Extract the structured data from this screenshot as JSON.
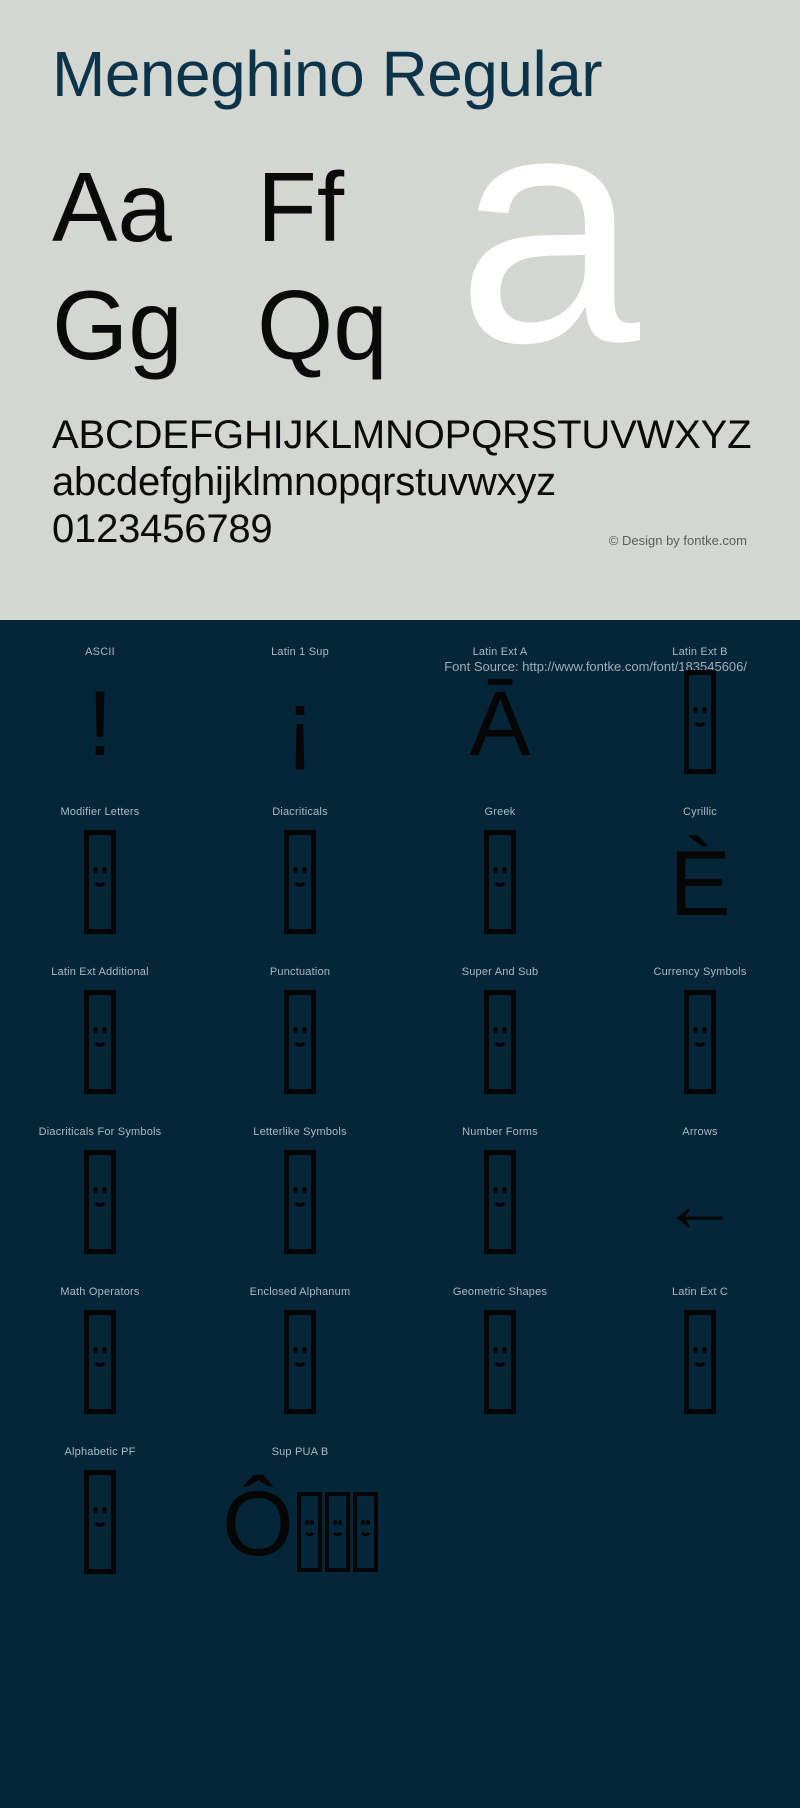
{
  "specimen": {
    "title": "Meneghino Regular",
    "watermark_letter": "a",
    "letter_pairs": [
      {
        "col1": "Aa",
        "col2": "Ff"
      },
      {
        "col1": "Gg",
        "col2": "Qq"
      }
    ],
    "alphabet_lines": [
      "ABCDEFGHIJKLMNOPQRSTUVWXYZ",
      "abcdefghijklmnopqrstuvwxyz",
      "0123456789"
    ],
    "design_credit": "© Design by fontke.com",
    "background_color": "#D4D7D1",
    "title_color": "#0B3349",
    "glyph_color": "#0A0A0A"
  },
  "blocks_section": {
    "font_source": "Font Source: http://www.fontke.com/font/183545606/",
    "background_color": "#052639",
    "label_color": "#A9BAC3",
    "blocks": [
      {
        "label": "ASCII",
        "glyph": "!",
        "kind": "char"
      },
      {
        "label": "Latin 1 Sup",
        "glyph": "¡",
        "kind": "char"
      },
      {
        "label": "Latin Ext A",
        "glyph": "Ā",
        "kind": "char"
      },
      {
        "label": "Latin Ext B",
        "glyph": "",
        "kind": "tofu"
      },
      {
        "label": "Modifier Letters",
        "glyph": "",
        "kind": "tofu"
      },
      {
        "label": "Diacriticals",
        "glyph": "",
        "kind": "tofu"
      },
      {
        "label": "Greek",
        "glyph": "",
        "kind": "tofu"
      },
      {
        "label": "Cyrillic",
        "glyph": "È",
        "kind": "char"
      },
      {
        "label": "Latin Ext Additional",
        "glyph": "",
        "kind": "tofu"
      },
      {
        "label": "Punctuation",
        "glyph": "",
        "kind": "tofu"
      },
      {
        "label": "Super And Sub",
        "glyph": "",
        "kind": "tofu"
      },
      {
        "label": "Currency Symbols",
        "glyph": "",
        "kind": "tofu"
      },
      {
        "label": "Diacriticals For Symbols",
        "glyph": "",
        "kind": "tofu"
      },
      {
        "label": "Letterlike Symbols",
        "glyph": "",
        "kind": "tofu"
      },
      {
        "label": "Number Forms",
        "glyph": "",
        "kind": "tofu"
      },
      {
        "label": "Arrows",
        "glyph": "←",
        "kind": "arrow"
      },
      {
        "label": "Math Operators",
        "glyph": "",
        "kind": "tofu"
      },
      {
        "label": "Enclosed Alphanum",
        "glyph": "",
        "kind": "tofu"
      },
      {
        "label": "Geometric Shapes",
        "glyph": "",
        "kind": "tofu"
      },
      {
        "label": "Latin Ext C",
        "glyph": "",
        "kind": "tofu"
      },
      {
        "label": "Alphabetic PF",
        "glyph": "",
        "kind": "tofu"
      },
      {
        "label": "Sup PUA B",
        "glyph": "Ô",
        "kind": "char-plus-tofu",
        "extra_tofu": 3
      }
    ]
  }
}
